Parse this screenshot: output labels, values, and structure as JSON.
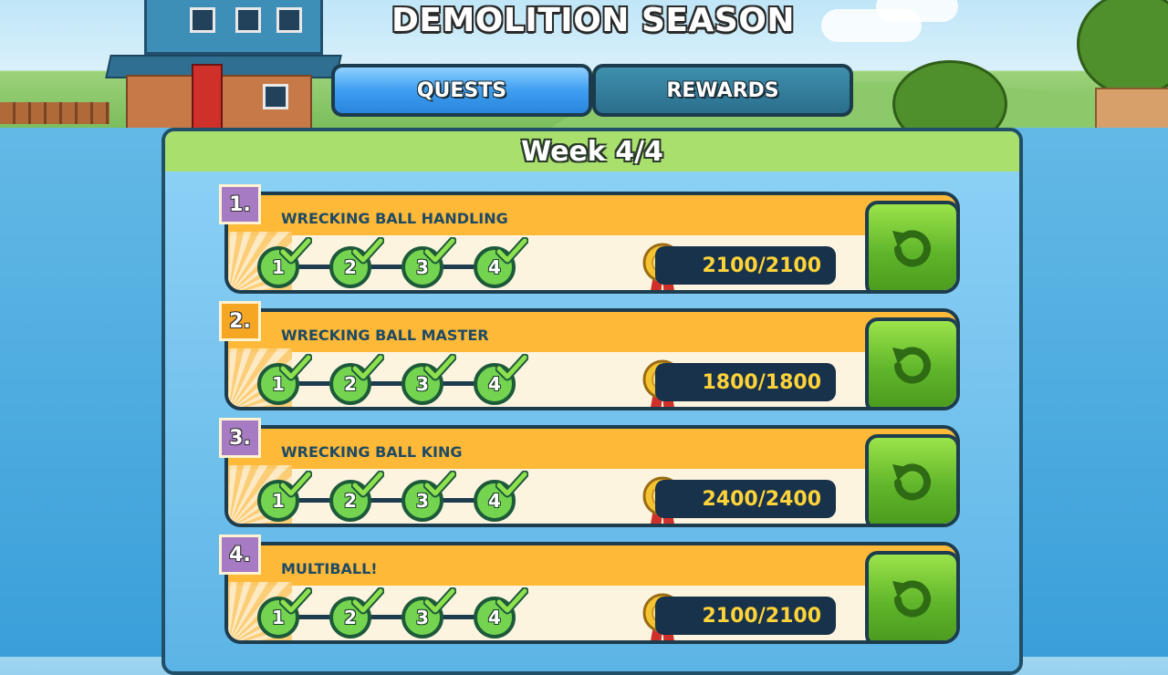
{
  "header": {
    "title": "DEMOLITION SEASON",
    "tabs": [
      {
        "label": "QUESTS",
        "active": true
      },
      {
        "label": "REWARDS",
        "active": false
      }
    ]
  },
  "panel": {
    "week_label": "Week 4/4"
  },
  "quests": [
    {
      "number": "1.",
      "name": "WRECKING BALL HANDLING",
      "stages": [
        "1",
        "2",
        "3",
        "4"
      ],
      "progress": "2100/2100",
      "badge_color": "#a77ac4"
    },
    {
      "number": "2.",
      "name": "WRECKING BALL MASTER",
      "stages": [
        "1",
        "2",
        "3",
        "4"
      ],
      "progress": "1800/1800",
      "badge_color": "#f5a623"
    },
    {
      "number": "3.",
      "name": "WRECKING BALL KING",
      "stages": [
        "1",
        "2",
        "3",
        "4"
      ],
      "progress": "2400/2400",
      "badge_color": "#a77ac4"
    },
    {
      "number": "4.",
      "name": "MULTIBALL!",
      "stages": [
        "1",
        "2",
        "3",
        "4"
      ],
      "progress": "2100/2100",
      "badge_color": "#a77ac4"
    }
  ],
  "icons": {
    "stage_complete": "checkmark-icon",
    "reward": "medal-icon",
    "replay": "restart-icon"
  },
  "colors": {
    "accent_blue": "#3e9ef0",
    "quest_strip": "#fdb937",
    "progress_text": "#ffd33a",
    "button_green": "#5fb52a"
  }
}
